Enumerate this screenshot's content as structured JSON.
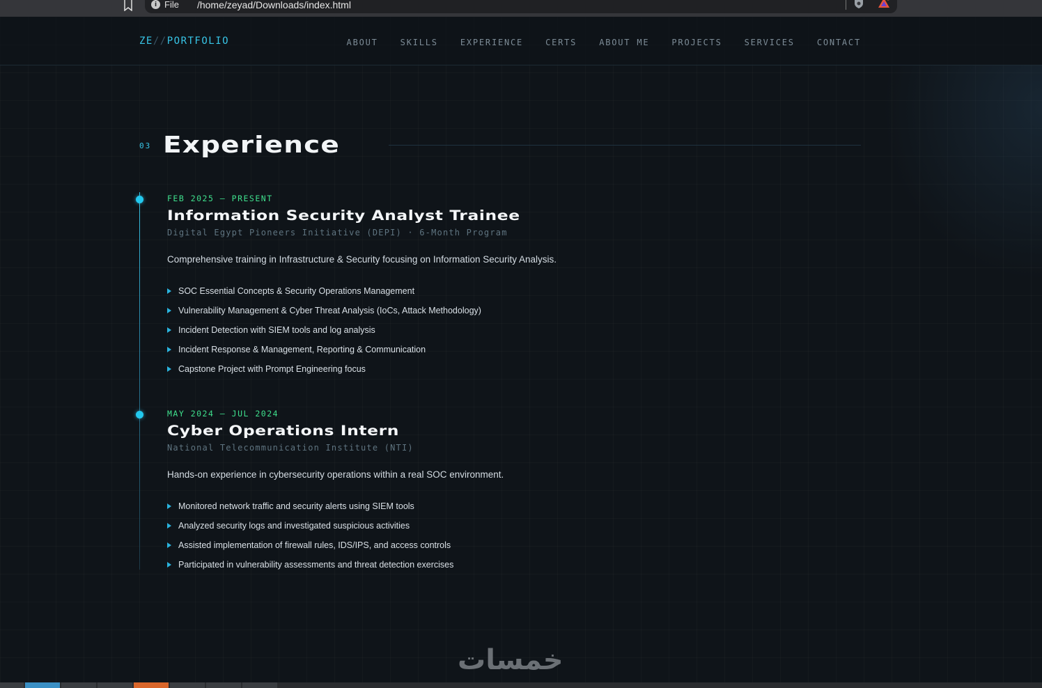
{
  "browser": {
    "scheme_label": "File",
    "url": "/home/zeyad/Downloads/index.html"
  },
  "logo": {
    "prefix": "ZE",
    "separator": "//",
    "suffix": "PORTFOLIO"
  },
  "nav": {
    "items": [
      {
        "label": "ABOUT"
      },
      {
        "label": "SKILLS"
      },
      {
        "label": "EXPERIENCE"
      },
      {
        "label": "CERTS"
      },
      {
        "label": "ABOUT ME"
      },
      {
        "label": "PROJECTS"
      },
      {
        "label": "SERVICES"
      },
      {
        "label": "CONTACT"
      }
    ]
  },
  "section": {
    "number": "03",
    "title": "Experience"
  },
  "experience": [
    {
      "date": "FEB 2025 — PRESENT",
      "title": "Information Security Analyst Trainee",
      "org": "Digital Egypt Pioneers Initiative (DEPI) · 6-Month Program",
      "description": "Comprehensive training in Infrastructure & Security focusing on Information Security Analysis.",
      "bullets": [
        "SOC Essential Concepts & Security Operations Management",
        "Vulnerability Management & Cyber Threat Analysis (IoCs, Attack Methodology)",
        "Incident Detection with SIEM tools and log analysis",
        "Incident Response & Management, Reporting & Communication",
        "Capstone Project with Prompt Engineering focus"
      ]
    },
    {
      "date": "MAY 2024 — JUL 2024",
      "title": "Cyber Operations Intern",
      "org": "National Telecommunication Institute (NTI)",
      "description": "Hands-on experience in cybersecurity operations within a real SOC environment.",
      "bullets": [
        "Monitored network traffic and security alerts using SIEM tools",
        "Analyzed security logs and investigated suspicious activities",
        "Assisted implementation of firewall rules, IDS/IPS, and access controls",
        "Participated in vulnerability assessments and threat detection exercises"
      ]
    }
  ],
  "watermark": {
    "text": "خمسات"
  },
  "colors": {
    "accent": "#38c6e8",
    "date_green": "#3fe08d",
    "background": "#0f1419"
  }
}
